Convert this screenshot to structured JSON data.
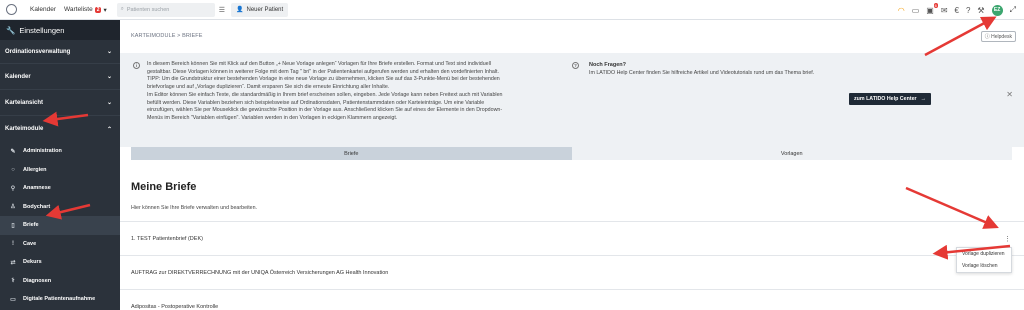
{
  "topbar": {
    "nav_calendar": "Kalender",
    "nav_waitlist": "Warteliste",
    "waitlist_count": "2",
    "search_placeholder": "Patienten suchen",
    "new_patient_label": "Neuer Patient",
    "notif_count": "6",
    "user_initials": "EZ"
  },
  "sidebar": {
    "title": "Einstellungen",
    "sections": [
      {
        "label": "Ordinationsverwaltung"
      },
      {
        "label": "Kalender"
      },
      {
        "label": "Karteiansicht"
      },
      {
        "label": "Karteimodule"
      }
    ],
    "sub_items": [
      {
        "label": "Administration",
        "icon": "pencil-icon"
      },
      {
        "label": "Allergien",
        "icon": "circle-icon"
      },
      {
        "label": "Anamnese",
        "icon": "tree-icon"
      },
      {
        "label": "Bodychart",
        "icon": "person-icon"
      },
      {
        "label": "Briefe",
        "icon": "document-icon"
      },
      {
        "label": "Cave",
        "icon": "exclamation-icon"
      },
      {
        "label": "Dekurs",
        "icon": "flow-icon"
      },
      {
        "label": "Diagnosen",
        "icon": "stethoscope-icon"
      },
      {
        "label": "Digitale Patientenaufnahme",
        "icon": "tablet-icon"
      }
    ]
  },
  "main": {
    "breadcrumb": "KARTEIMODULE > BRIEFE",
    "helpdesk": "Helpdesk",
    "info_lines": [
      "In diesem Bereich können Sie mit Klick auf den Button „+ Neue Vorlage anlegen“ Vorlagen für Ihre Briefe erstellen. Format und Text sind individuell",
      "gestaltbar. Diese Vorlagen können in weiterer Folge mit dem Tag \" bri\" in der Patientenkartei aufgerufen werden und erhalten den vordefinierten Inhalt.",
      "TIPP: Um die Grundstruktur einer bestehenden Vorlage in eine neue Vorlage zu übernehmen, klicken Sie auf das 3-Punkte-Menü bei der bestehenden",
      "briefvorlage und auf „Vorlage duplizieren“. Damit ersparen Sie sich die erneute Einrichtung aller Inhalte.",
      "Im Editor können Sie einfach Texte, die standardmäßig in Ihrem brief erscheinen sollen, eingeben. Jede Vorlage kann neben Freitext auch mit Variablen",
      "befüllt werden. Diese Variablen beziehen sich beispielsweise auf Ordinationsdaten, Patientenstammdaten oder Karteieinträge. Um eine Variable",
      "einzufügen, wählen Sie per Mouseklick die gewünschte Position in der Vorlage aus. Anschließend klicken Sie auf eines der Elemente in den Dropdown-",
      "Menüs im Bereich \"Variablen einfügen\". Variablen werden in den Vorlagen in eckigen Klammern angezeigt."
    ],
    "help_title": "Noch Fragen?",
    "help_text": "Im LATIDO Help Center finden Sie hilfreiche Artikel und Videotutorials rund um das Thema brief.",
    "help_button": "zum LATIDO Help Center",
    "tabs": [
      {
        "label": "Briefe",
        "active": true
      },
      {
        "label": "Vorlagen",
        "active": false
      }
    ],
    "title": "Meine Briefe",
    "subtitle": "Hier können Sie Ihre Briefe verwalten und bearbeiten.",
    "rows": [
      {
        "label": "1. TEST Patientenbrief (DEK)"
      },
      {
        "label": "AUFTRAG zur DIREKTVERRECHNUNG mit der UNIQA Österreich Versicherungen AG Health Innovation"
      },
      {
        "label": "Adipositas - Postoperative Kontrolle"
      }
    ],
    "dropdown": [
      {
        "label": "Vorlage duplizieren"
      },
      {
        "label": "Vorlage löschen"
      }
    ]
  },
  "colors": {
    "sidebar_bg": "#2b323b",
    "accent_red": "#e53935",
    "help_button_bg": "#1f2a36",
    "tab_active_bg": "#c9d2db"
  }
}
